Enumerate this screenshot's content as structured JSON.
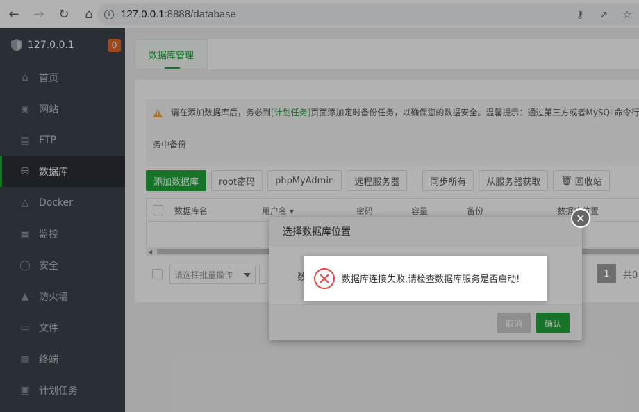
{
  "browser": {
    "url_host": "127.0.0.1",
    "url_rest": ":8888/database"
  },
  "sidebar": {
    "server_name": "127.0.0.1",
    "badge_count": "0",
    "items": [
      {
        "label": "首页",
        "icon": "home-icon"
      },
      {
        "label": "网站",
        "icon": "globe-icon"
      },
      {
        "label": "FTP",
        "icon": "ftp-icon"
      },
      {
        "label": "数据库",
        "icon": "database-icon",
        "active": true
      },
      {
        "label": "Docker",
        "icon": "docker-icon"
      },
      {
        "label": "监控",
        "icon": "monitor-icon"
      },
      {
        "label": "安全",
        "icon": "shield-icon"
      },
      {
        "label": "防火墙",
        "icon": "firewall-icon"
      },
      {
        "label": "文件",
        "icon": "folder-icon"
      },
      {
        "label": "终端",
        "icon": "terminal-icon"
      },
      {
        "label": "计划任务",
        "icon": "calendar-icon"
      }
    ]
  },
  "main": {
    "tab_label": "数据库管理",
    "warning_pre": "请在添加数据库后，务必到",
    "warning_link": "[计划任务]",
    "warning_post": "页面添加定时备份任务，以确保您的数据安全。温馨提示：通过第三方或者MySQL命令行",
    "warning_line2": "务中备份",
    "toolbar": {
      "add": "添加数据库",
      "root_pwd": "root密码",
      "phpmyadmin": "phpMyAdmin",
      "remote": "远程服务器",
      "sync_all": "同步所有",
      "fetch": "从服务器获取",
      "recycle": "回收站"
    },
    "columns": [
      "数据库名",
      "用户名",
      "密码",
      "容量",
      "备份",
      "数据库位置"
    ],
    "batch_placeholder": "请选择批量操作",
    "page_current": "1",
    "page_total_prefix": "共0"
  },
  "modal": {
    "title": "选择数据库位置",
    "body_label": "数",
    "cancel": "取消",
    "confirm": "确认"
  },
  "toast": {
    "message": "数据库连接失败,请检查数据库服务是否启动!"
  },
  "colors": {
    "accent": "#20a53a",
    "sidebar_bg": "#3c444d",
    "error": "#e8443b"
  }
}
